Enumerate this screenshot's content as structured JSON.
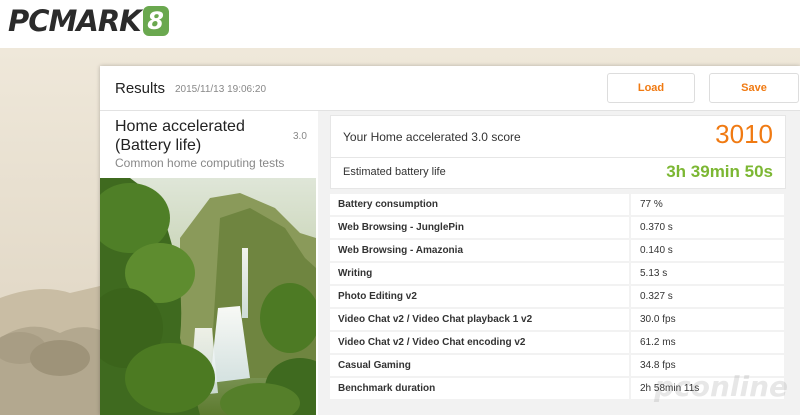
{
  "app": {
    "logo_text": "PCMARK",
    "logo_badge": "8"
  },
  "results": {
    "title": "Results",
    "date": "2015/11/13 19:06:20",
    "load_label": "Load",
    "save_label": "Save"
  },
  "benchmark": {
    "name": "Home accelerated (Battery life)",
    "version": "3.0",
    "description": "Common home computing tests"
  },
  "score": {
    "label": "Your Home accelerated 3.0 score",
    "value": "3010"
  },
  "battery": {
    "label": "Estimated battery life",
    "value": "3h 39min 50s"
  },
  "details": [
    {
      "name": "Battery consumption",
      "value": "77 %"
    },
    {
      "name": "Web Browsing - JunglePin",
      "value": "0.370 s"
    },
    {
      "name": "Web Browsing - Amazonia",
      "value": "0.140 s"
    },
    {
      "name": "Writing",
      "value": "5.13 s"
    },
    {
      "name": "Photo Editing v2",
      "value": "0.327 s"
    },
    {
      "name": "Video Chat v2 / Video Chat playback 1 v2",
      "value": "30.0 fps"
    },
    {
      "name": "Video Chat v2 / Video Chat encoding v2",
      "value": "61.2 ms"
    },
    {
      "name": "Casual Gaming",
      "value": "34.8 fps"
    },
    {
      "name": "Benchmark duration",
      "value": "2h 58min 11s"
    }
  ],
  "watermark": "pconline",
  "colors": {
    "accent_orange": "#f07a12",
    "battery_green": "#7cb733",
    "logo_green": "#6aa84f"
  }
}
